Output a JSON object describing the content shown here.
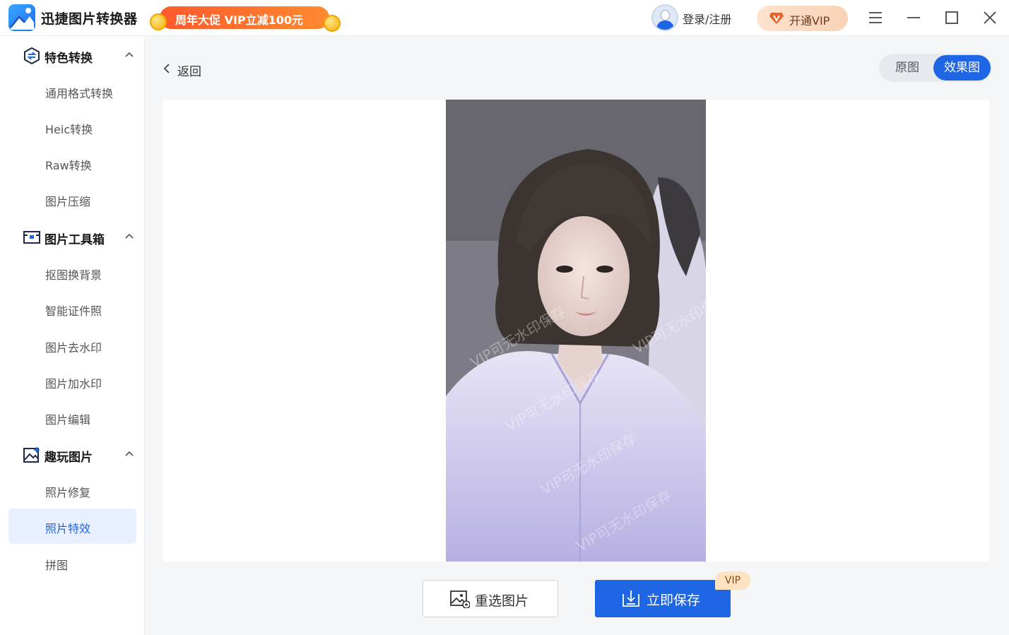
{
  "app": {
    "title": "迅捷图片转换器",
    "promo": "周年大促 VIP立减100元",
    "login": "登录/注册",
    "vip_button": "开通VIP"
  },
  "colors": {
    "accent": "#1f66e5",
    "promo": "#ff6a2c",
    "vip_bg": "#fbdcc4"
  },
  "sidebar": {
    "groups": [
      {
        "label": "特色转换",
        "icon": "convert-icon",
        "items": [
          "通用格式转换",
          "Heic转换",
          "Raw转换",
          "图片压缩"
        ]
      },
      {
        "label": "图片工具箱",
        "icon": "toolbox-icon",
        "items": [
          "抠图换背景",
          "智能证件照",
          "图片去水印",
          "图片加水印",
          "图片编辑"
        ]
      },
      {
        "label": "趣玩图片",
        "icon": "image-play-icon",
        "items": [
          "照片修复",
          "照片特效",
          "拼图"
        ]
      }
    ],
    "active_item": "照片特效"
  },
  "main": {
    "back": "返回",
    "toggle": {
      "original": "原图",
      "effect": "效果图",
      "selected": "效果图"
    },
    "watermark": "VIP可无水印保存",
    "reselect": "重选图片",
    "save": "立即保存",
    "save_badge": "VIP"
  }
}
